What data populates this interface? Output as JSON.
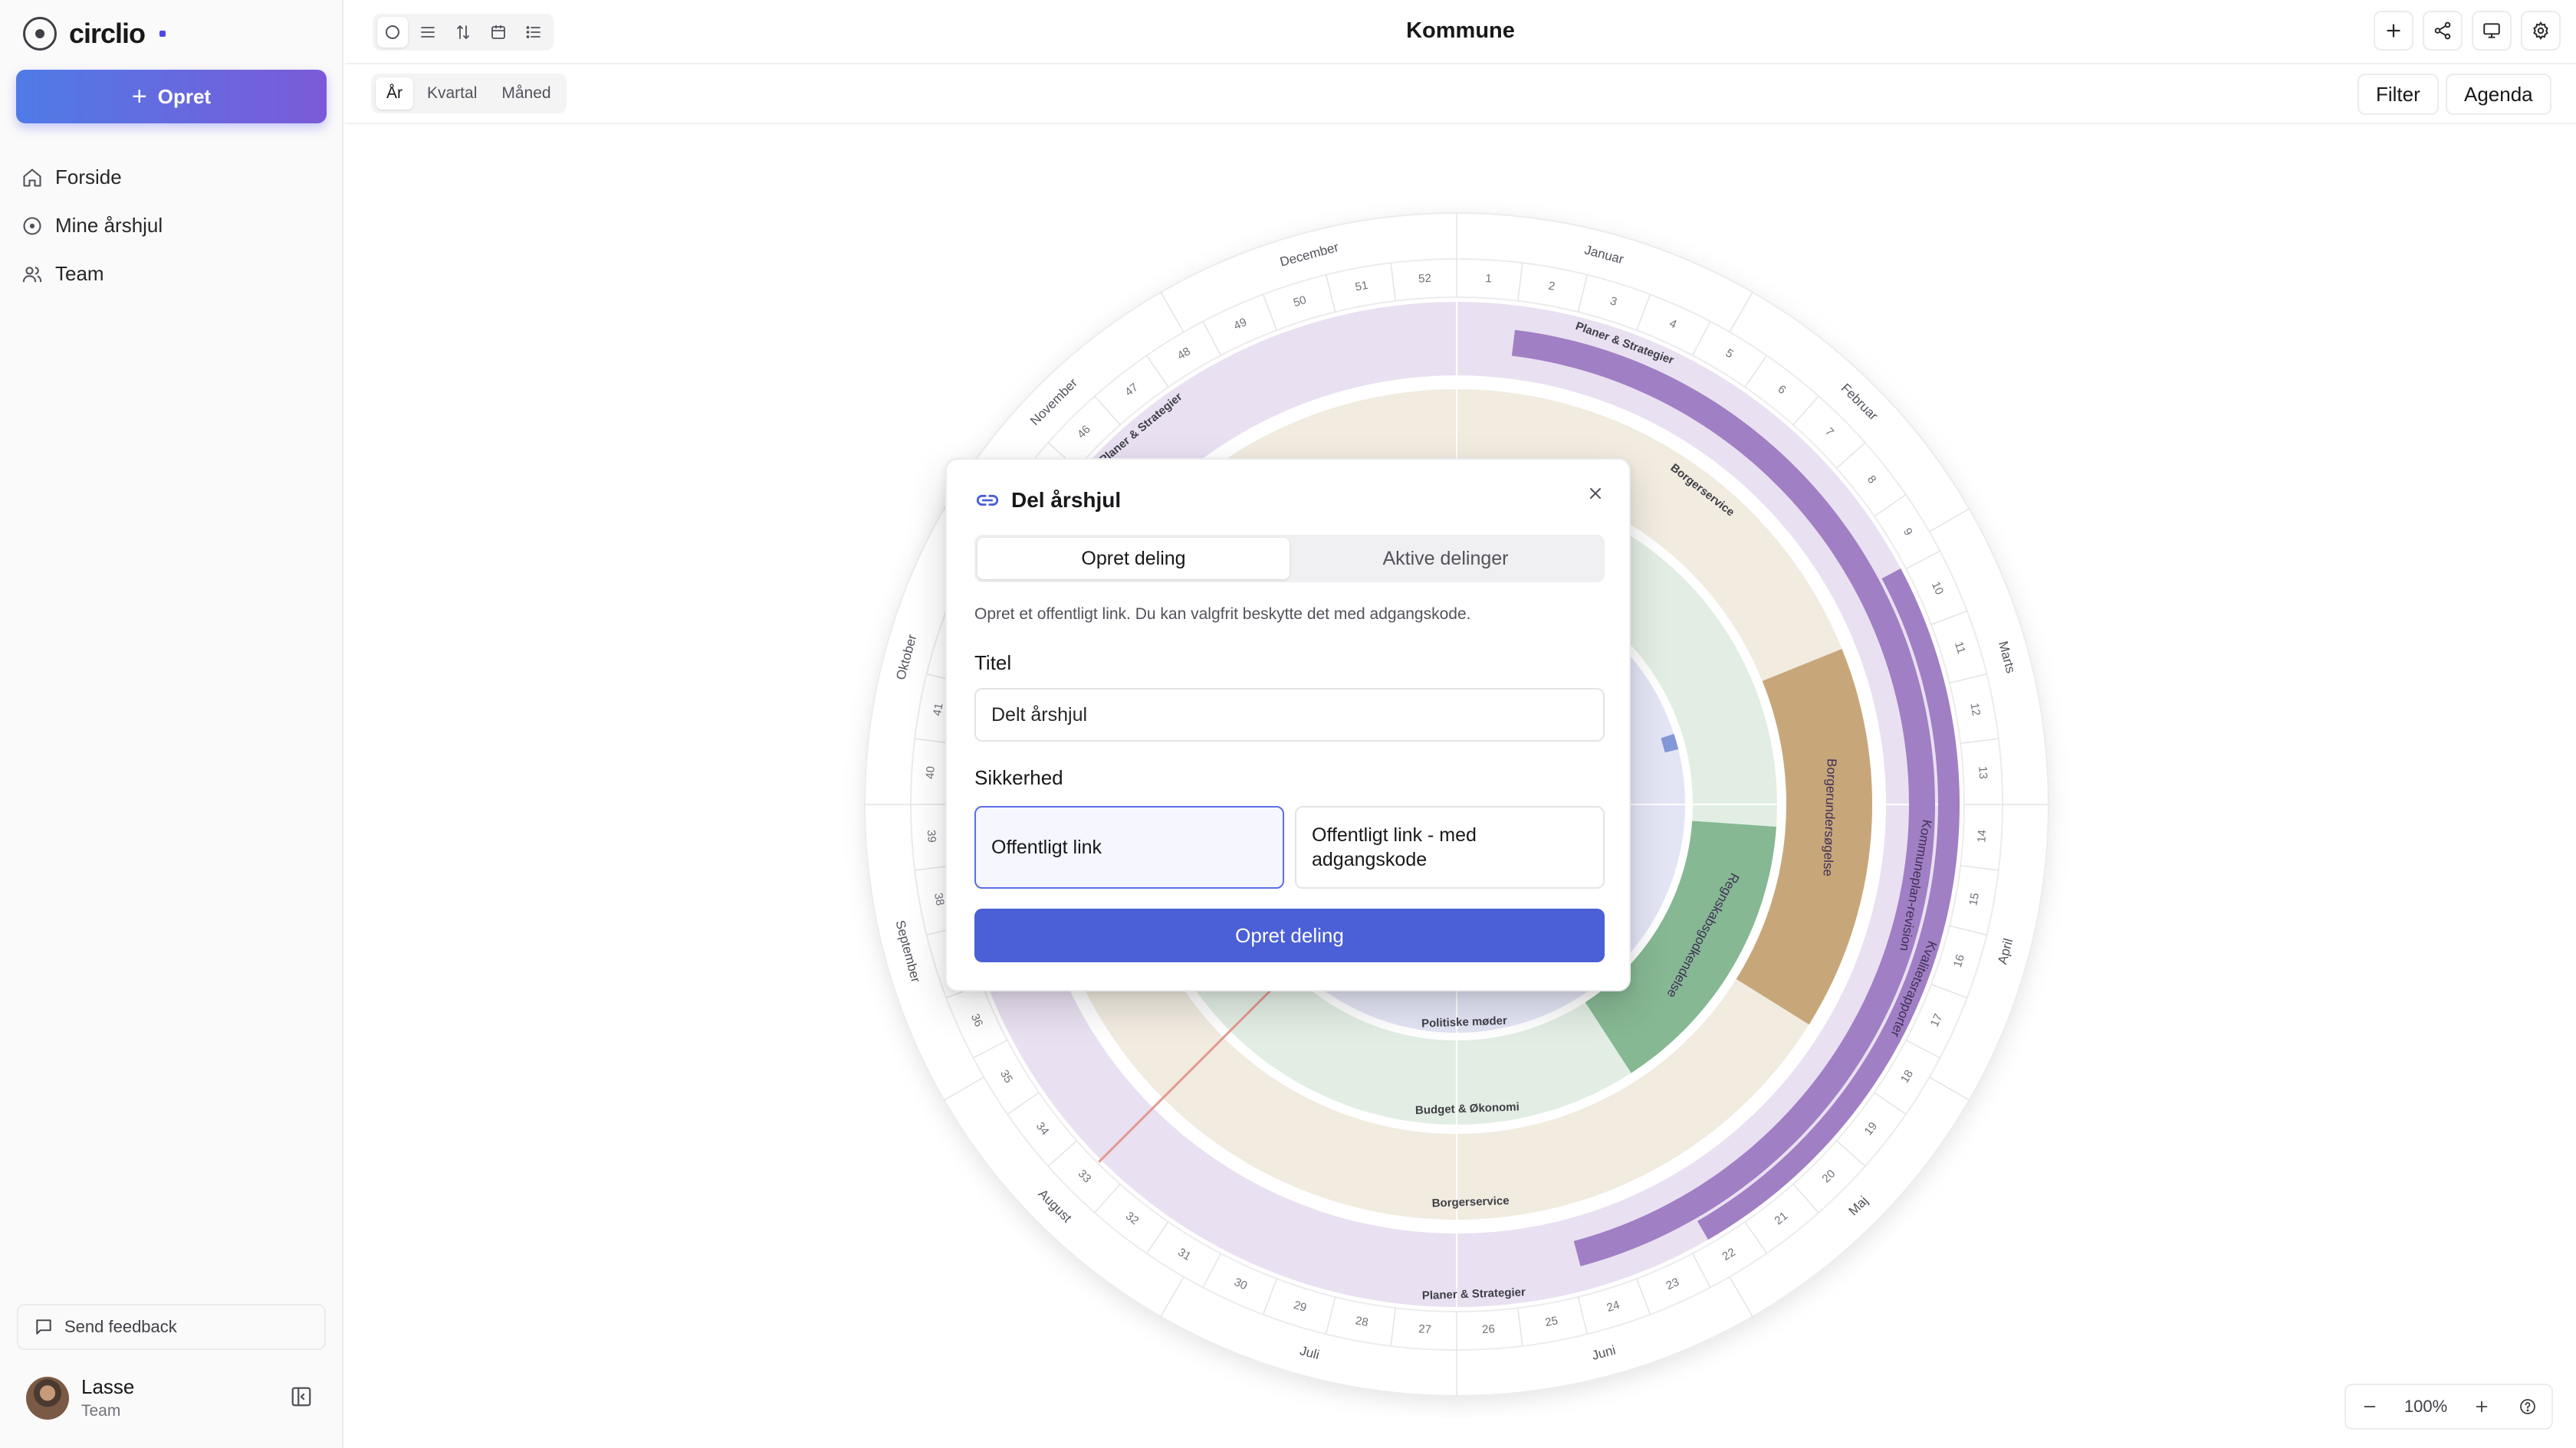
{
  "app": {
    "name": "circlio"
  },
  "sidebar": {
    "create_label": "Opret",
    "items": [
      {
        "label": "Forside",
        "icon": "home-icon"
      },
      {
        "label": "Mine årshjul",
        "icon": "circle-dot-icon"
      },
      {
        "label": "Team",
        "icon": "users-icon"
      }
    ],
    "feedback_label": "Send feedback",
    "user": {
      "name": "Lasse",
      "role": "Team"
    }
  },
  "header": {
    "title": "Kommune",
    "view_icons": [
      "circle-icon",
      "list-icon",
      "sort-icon",
      "calendar-icon",
      "list-bullets-icon"
    ],
    "actions": [
      "plus-icon",
      "share-icon",
      "present-icon",
      "settings-icon"
    ]
  },
  "period": {
    "options": [
      "År",
      "Kvartal",
      "Måned"
    ],
    "selected": "År"
  },
  "toolbar": {
    "filter_label": "Filter",
    "agenda_label": "Agenda"
  },
  "zoom": {
    "value": "100%"
  },
  "wheel": {
    "months": [
      "Januar",
      "Februar",
      "Marts",
      "April",
      "Maj",
      "Juni",
      "Juli",
      "August",
      "September",
      "Oktober",
      "November",
      "December"
    ],
    "ring_labels": {
      "outer": "Planer & Strategier",
      "service": "Borgerservice",
      "budget": "Budget & Økonomi",
      "meetings": "Politiske møder"
    },
    "event_labels": [
      "Kommuneplan-revision",
      "Kvalitetsrapporter",
      "Borgerundersøgelse",
      "Regnskabsgodkendelse"
    ],
    "colors": {
      "purple_light": "#e9e0f1",
      "purple": "#a07fc4",
      "tan_light": "#f1ebe0",
      "tan": "#c7a77a",
      "green_light": "#e2eee4",
      "green": "#86b893",
      "blue_light": "#e3e5f5",
      "blue": "#8297d6",
      "today_line": "#e59a92"
    }
  },
  "modal": {
    "title": "Del årshjul",
    "tabs": [
      "Opret deling",
      "Aktive delinger"
    ],
    "active_tab": "Opret deling",
    "description": "Opret et offentligt link. Du kan valgfrit beskytte det med adgangskode.",
    "title_label": "Titel",
    "title_value": "Delt årshjul",
    "security_label": "Sikkerhed",
    "security_options": [
      "Offentligt link",
      "Offentligt link - med adgangskode"
    ],
    "security_selected": "Offentligt link",
    "submit_label": "Opret deling"
  }
}
